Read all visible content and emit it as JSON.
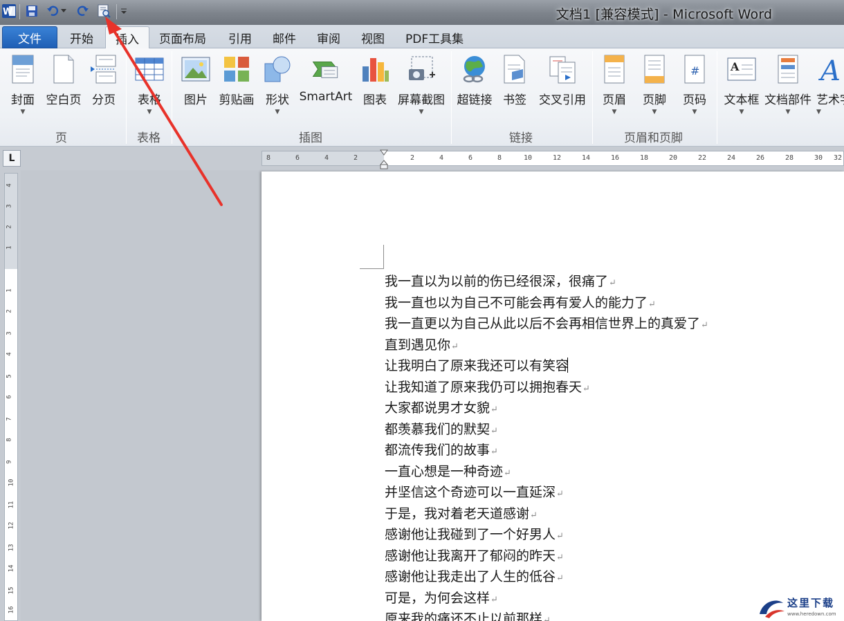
{
  "window": {
    "title": "文档1 [兼容模式] - Microsoft Word"
  },
  "quick_access": {
    "icons": [
      "word-logo-icon",
      "save-icon",
      "undo-icon",
      "redo-icon",
      "print-preview-icon",
      "customize-qat-icon"
    ]
  },
  "tabs": {
    "file": "文件",
    "items": [
      "开始",
      "插入",
      "页面布局",
      "引用",
      "邮件",
      "审阅",
      "视图",
      "PDF工具集"
    ],
    "active": "插入"
  },
  "ribbon": {
    "groups": {
      "pages": "页",
      "tables": "表格",
      "illustrations": "插图",
      "links": "链接",
      "header_footer": "页眉和页脚"
    },
    "buttons": {
      "cover": "封面",
      "blank_page": "空白页",
      "page_break": "分页",
      "table": "表格",
      "picture": "图片",
      "clip_art": "剪贴画",
      "shapes": "形状",
      "smartart": "SmartArt",
      "chart": "图表",
      "screenshot": "屏幕截图",
      "hyperlink": "超链接",
      "bookmark": "书签",
      "cross_ref": "交叉引用",
      "header": "页眉",
      "footer": "页脚",
      "page_number": "页码",
      "text_box": "文本框",
      "quick_parts": "文档部件",
      "wordart": "艺术字"
    }
  },
  "ruler": {
    "corner": "L",
    "h_ticks": [
      "8",
      "6",
      "4",
      "2",
      "2",
      "4",
      "6",
      "8",
      "10",
      "12",
      "14",
      "16",
      "18",
      "20",
      "22",
      "24",
      "26",
      "28",
      "30",
      "32"
    ],
    "v_ticks": [
      "4",
      "3",
      "2",
      "1",
      "1",
      "2",
      "3",
      "4",
      "5",
      "6",
      "7",
      "8",
      "9",
      "10",
      "11",
      "12",
      "13",
      "14",
      "15",
      "16"
    ]
  },
  "document": {
    "lines": [
      "我一直以为以前的伤已经很深，很痛了",
      "我一直也以为自己不可能会再有爱人的能力了",
      "我一直更以为自己从此以后不会再相信世界上的真爱了",
      "直到遇见你",
      "让我明白了原来我还可以有笑容",
      "让我知道了原来我仍可以拥抱春天",
      "大家都说男才女貌",
      "都羡慕我们的默契",
      "都流传我们的故事",
      "一直心想是一种奇迹",
      "并坚信这个奇迹可以一直延深",
      "于是，我对着老天道感谢",
      "感谢他让我碰到了一个好男人",
      "感谢他让我离开了郁闷的昨天",
      "感谢他让我走出了人生的低谷",
      "可是，为何会这样",
      "原来我的痛还不止以前那样"
    ],
    "para_mark": "↵"
  },
  "watermark": {
    "name": "这里下载",
    "url": "www.heredown.com"
  },
  "colors": {
    "file_tab": "#2a6fc9",
    "arrow": "#e8322a"
  }
}
